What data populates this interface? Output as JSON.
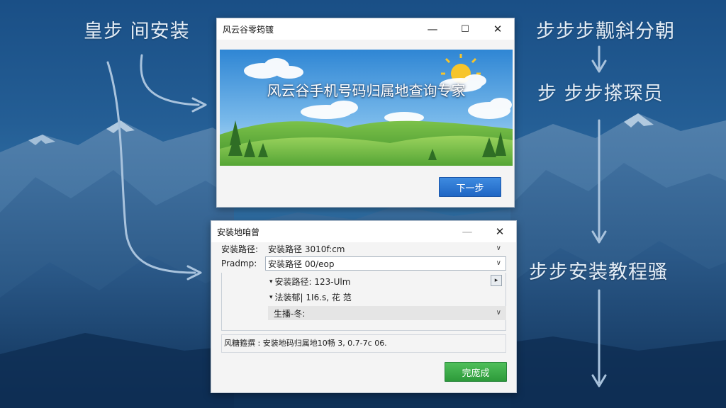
{
  "background": {
    "left_label": "皇步 间安装",
    "right_steps": [
      "步步步觏斜分朝",
      "步 步步搽琛员",
      "步步安装教程骚"
    ]
  },
  "dialog_top": {
    "title": "风云谷零筠镀",
    "banner_text": "风云谷手机号码归属地查询专家",
    "next_button": "下一步",
    "minimize_glyph": "—",
    "maximize_glyph": "☐",
    "close_glyph": "✕"
  },
  "dialog_bottom": {
    "title": "安装地咱曾",
    "minimize_glyph": "—",
    "close_glyph": "✕",
    "row1_label": "安装路径:",
    "row1_value": "安装路径 3010f:cm",
    "row2_label": "Pradmp:",
    "row2_value": "安装路径 00/eop",
    "sub_option_1": "安装路径: 123-Ulm",
    "sub_option_2": "法装郁| 1I6.s, 花 范",
    "sub_option_3": "生播-冬:",
    "status_text": "风糖箍撰 : 安装地码归属地10畅 3, 0.7-7c 06.",
    "finish_button": "完庞成"
  },
  "colors": {
    "next_button": "#2b78d4",
    "finish_button": "#3aae48",
    "background": "#2a6498"
  }
}
